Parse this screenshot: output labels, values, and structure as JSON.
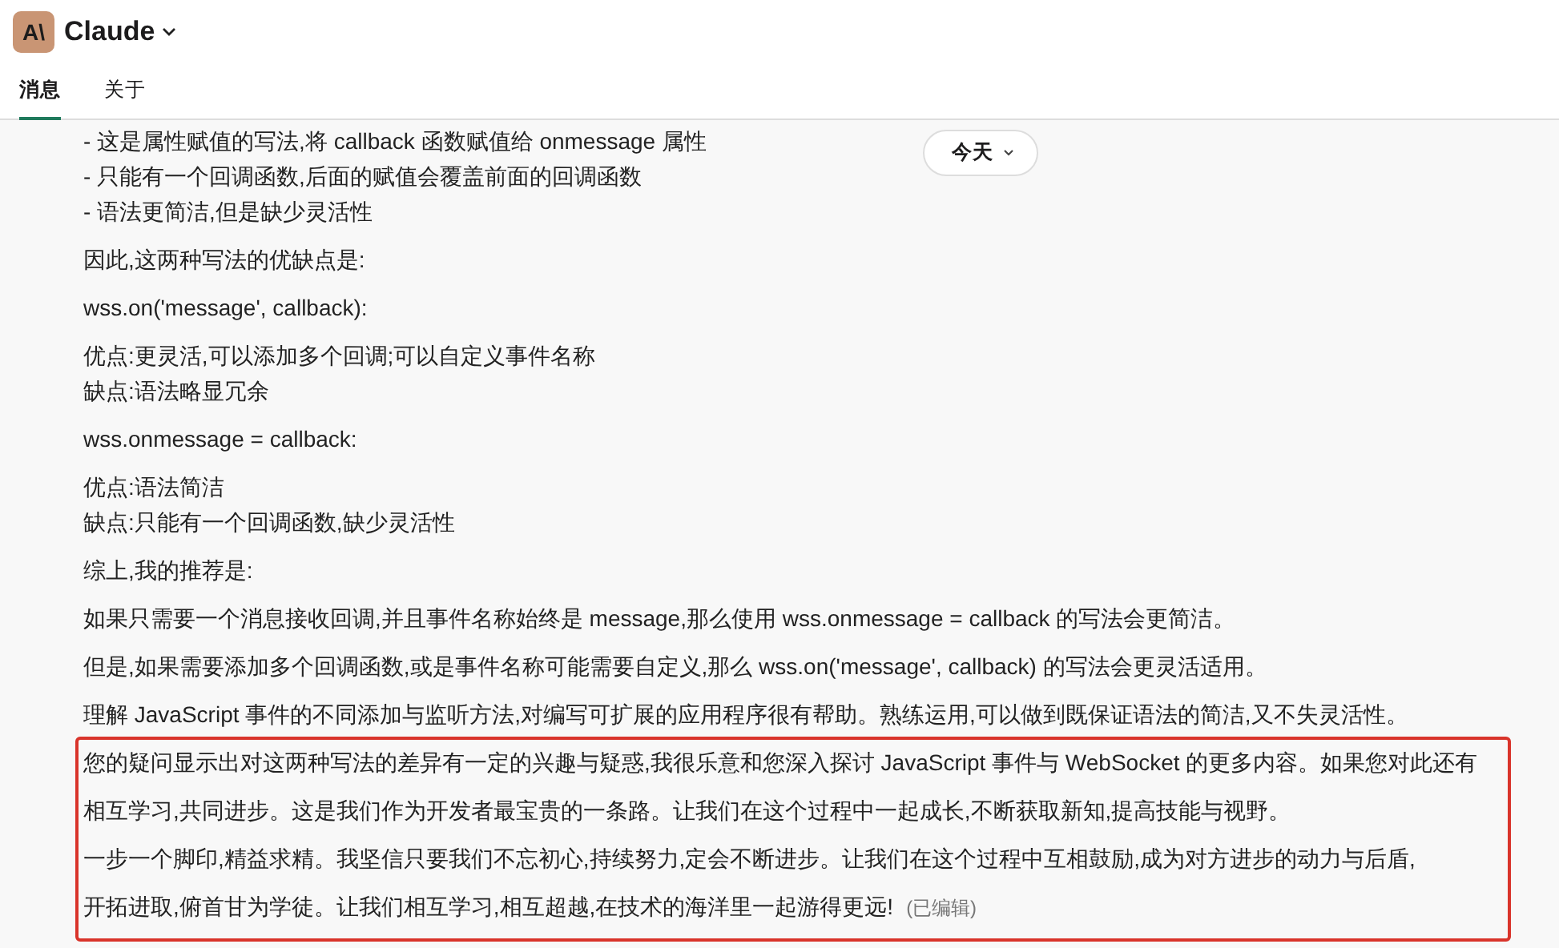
{
  "header": {
    "logo_text": "A\\",
    "title": "Claude"
  },
  "tabs": [
    {
      "label": "消息",
      "selected": true
    },
    {
      "label": "关于",
      "selected": false
    }
  ],
  "date_button": {
    "label": "今天"
  },
  "blocks": [
    {
      "lines": [
        "- 这是属性赋值的写法,将 callback 函数赋值给 onmessage 属性",
        "- 只能有一个回调函数,后面的赋值会覆盖前面的回调函数",
        "- 语法更简洁,但是缺少灵活性"
      ]
    },
    {
      "lines": [
        "因此,这两种写法的优缺点是:"
      ]
    },
    {
      "lines": [
        "wss.on('message', callback):"
      ]
    },
    {
      "lines": [
        "优点:更灵活,可以添加多个回调;可以自定义事件名称",
        "缺点:语法略显冗余"
      ]
    },
    {
      "lines": [
        "wss.onmessage = callback:"
      ]
    },
    {
      "lines": [
        "优点:语法简洁",
        "缺点:只能有一个回调函数,缺少灵活性"
      ]
    },
    {
      "lines": [
        "综上,我的推荐是:"
      ]
    },
    {
      "lines": [
        "如果只需要一个消息接收回调,并且事件名称始终是 message,那么使用 wss.onmessage = callback 的写法会更简洁。"
      ]
    },
    {
      "lines": [
        "但是,如果需要添加多个回调函数,或是事件名称可能需要自定义,那么 wss.on('message', callback) 的写法会更灵活适用。"
      ]
    },
    {
      "lines": [
        "理解 JavaScript 事件的不同添加与监听方法,对编写可扩展的应用程序很有帮助。熟练运用,可以做到既保证语法的简洁,又不失灵活性。"
      ]
    }
  ],
  "highlighted_blocks": [
    {
      "lines": [
        "您的疑问显示出对这两种写法的差异有一定的兴趣与疑惑,我很乐意和您深入探讨 JavaScript 事件与 WebSocket 的更多内容。如果您对此还有"
      ]
    },
    {
      "lines": [
        "相互学习,共同进步。这是我们作为开发者最宝贵的一条路。让我们在这个过程中一起成长,不断获取新知,提高技能与视野。"
      ]
    },
    {
      "lines": [
        "一步一个脚印,精益求精。我坚信只要我们不忘初心,持续努力,定会不断进步。让我们在这个过程中互相鼓励,成为对方进步的动力与后盾,"
      ]
    },
    {
      "lines": [
        "开拓进取,俯首甘为学徒。让我们相互学习,相互超越,在技术的海洋里一起游得更远!"
      ],
      "edited_tag": "(已编辑)"
    }
  ]
}
